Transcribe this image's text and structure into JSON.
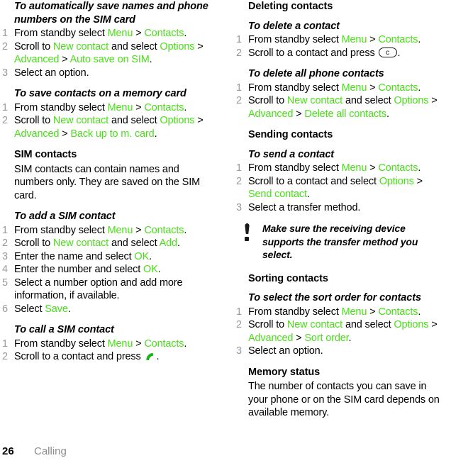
{
  "meta": {
    "accent_green": "#4ade18",
    "step_number_gray": "#9a9a9a",
    "footer_gray": "#8c8c8c"
  },
  "footer": {
    "page_number": "26",
    "chapter": "Calling"
  },
  "left_column": {
    "blocks": [
      {
        "type": "procedure",
        "title": "To automatically save names and phone numbers on the SIM card",
        "steps": [
          {
            "num": "1",
            "parts": [
              {
                "t": "From standby select ",
                "k": false
              },
              {
                "t": "Menu",
                "k": true
              },
              {
                "t": " > ",
                "k": false
              },
              {
                "t": "Contacts",
                "k": true
              },
              {
                "t": ".",
                "k": false
              }
            ]
          },
          {
            "num": "2",
            "parts": [
              {
                "t": "Scroll to ",
                "k": false
              },
              {
                "t": "New contact",
                "k": true
              },
              {
                "t": " and select ",
                "k": false
              },
              {
                "t": "Options",
                "k": true
              },
              {
                "t": " > ",
                "k": false
              },
              {
                "t": "Advanced",
                "k": true
              },
              {
                "t": " > ",
                "k": false
              },
              {
                "t": "Auto save on SIM",
                "k": true
              },
              {
                "t": ".",
                "k": false
              }
            ]
          },
          {
            "num": "3",
            "parts": [
              {
                "t": "Select an option.",
                "k": false
              }
            ]
          }
        ]
      },
      {
        "type": "procedure",
        "title": "To save contacts on a memory card",
        "steps": [
          {
            "num": "1",
            "parts": [
              {
                "t": "From standby select ",
                "k": false
              },
              {
                "t": "Menu",
                "k": true
              },
              {
                "t": " > ",
                "k": false
              },
              {
                "t": "Contacts",
                "k": true
              },
              {
                "t": ".",
                "k": false
              }
            ]
          },
          {
            "num": "2",
            "parts": [
              {
                "t": "Scroll to ",
                "k": false
              },
              {
                "t": "New contact",
                "k": true
              },
              {
                "t": " and select ",
                "k": false
              },
              {
                "t": "Options",
                "k": true
              },
              {
                "t": " > ",
                "k": false
              },
              {
                "t": "Advanced",
                "k": true
              },
              {
                "t": " > ",
                "k": false
              },
              {
                "t": "Back up to m. card",
                "k": true
              },
              {
                "t": ".",
                "k": false
              }
            ]
          }
        ]
      },
      {
        "type": "section",
        "title": "SIM contacts",
        "paragraph": "SIM contacts can contain names and numbers only. They are saved on the SIM card."
      },
      {
        "type": "procedure",
        "title": "To add a SIM contact",
        "steps": [
          {
            "num": "1",
            "parts": [
              {
                "t": "From standby select ",
                "k": false
              },
              {
                "t": "Menu",
                "k": true
              },
              {
                "t": " > ",
                "k": false
              },
              {
                "t": "Contacts",
                "k": true
              },
              {
                "t": ".",
                "k": false
              }
            ]
          },
          {
            "num": "2",
            "parts": [
              {
                "t": "Scroll to ",
                "k": false
              },
              {
                "t": "New contact",
                "k": true
              },
              {
                "t": " and select ",
                "k": false
              },
              {
                "t": "Add",
                "k": true
              },
              {
                "t": ".",
                "k": false
              }
            ]
          },
          {
            "num": "3",
            "parts": [
              {
                "t": "Enter the name and select ",
                "k": false
              },
              {
                "t": "OK",
                "k": true
              },
              {
                "t": ".",
                "k": false
              }
            ]
          },
          {
            "num": "4",
            "parts": [
              {
                "t": "Enter the number and select ",
                "k": false
              },
              {
                "t": "OK",
                "k": true
              },
              {
                "t": ".",
                "k": false
              }
            ]
          },
          {
            "num": "5",
            "parts": [
              {
                "t": "Select a number option and add more information, if available.",
                "k": false
              }
            ]
          },
          {
            "num": "6",
            "parts": [
              {
                "t": "Select ",
                "k": false
              },
              {
                "t": "Save",
                "k": true
              },
              {
                "t": ".",
                "k": false
              }
            ]
          }
        ]
      },
      {
        "type": "procedure",
        "title": "To call a SIM contact",
        "steps": [
          {
            "num": "1",
            "parts": [
              {
                "t": "From standby select ",
                "k": false
              },
              {
                "t": "Menu",
                "k": true
              },
              {
                "t": " > ",
                "k": false
              },
              {
                "t": "Contacts",
                "k": true
              },
              {
                "t": ".",
                "k": false
              }
            ]
          },
          {
            "num": "2",
            "parts": [
              {
                "t": "Scroll to a contact and press ",
                "k": false
              },
              {
                "icon": "call-key-icon"
              },
              {
                "t": ".",
                "k": false
              }
            ]
          }
        ]
      }
    ]
  },
  "right_column": {
    "blocks": [
      {
        "type": "section",
        "title": "Deleting contacts"
      },
      {
        "type": "procedure",
        "title": "To delete a contact",
        "steps": [
          {
            "num": "1",
            "parts": [
              {
                "t": "From standby select ",
                "k": false
              },
              {
                "t": "Menu",
                "k": true
              },
              {
                "t": " > ",
                "k": false
              },
              {
                "t": "Contacts",
                "k": true
              },
              {
                "t": ".",
                "k": false
              }
            ]
          },
          {
            "num": "2",
            "parts": [
              {
                "t": "Scroll to a contact and press ",
                "k": false
              },
              {
                "icon": "clear-key-icon",
                "label": "c"
              },
              {
                "t": ".",
                "k": false
              }
            ]
          }
        ]
      },
      {
        "type": "procedure",
        "title": "To delete all phone contacts",
        "steps": [
          {
            "num": "1",
            "parts": [
              {
                "t": "From standby select ",
                "k": false
              },
              {
                "t": "Menu",
                "k": true
              },
              {
                "t": " > ",
                "k": false
              },
              {
                "t": "Contacts",
                "k": true
              },
              {
                "t": ".",
                "k": false
              }
            ]
          },
          {
            "num": "2",
            "parts": [
              {
                "t": "Scroll to ",
                "k": false
              },
              {
                "t": "New contact",
                "k": true
              },
              {
                "t": " and select ",
                "k": false
              },
              {
                "t": "Options",
                "k": true
              },
              {
                "t": " > ",
                "k": false
              },
              {
                "t": "Advanced",
                "k": true
              },
              {
                "t": " > ",
                "k": false
              },
              {
                "t": "Delete all contacts",
                "k": true
              },
              {
                "t": ".",
                "k": false
              }
            ]
          }
        ]
      },
      {
        "type": "section",
        "title": "Sending contacts"
      },
      {
        "type": "procedure",
        "title": "To send a contact",
        "steps": [
          {
            "num": "1",
            "parts": [
              {
                "t": "From standby select ",
                "k": false
              },
              {
                "t": "Menu",
                "k": true
              },
              {
                "t": " > ",
                "k": false
              },
              {
                "t": "Contacts",
                "k": true
              },
              {
                "t": ".",
                "k": false
              }
            ]
          },
          {
            "num": "2",
            "parts": [
              {
                "t": "Scroll to a contact and select ",
                "k": false
              },
              {
                "t": "Options",
                "k": true
              },
              {
                "t": " > ",
                "k": false
              },
              {
                "t": "Send contact",
                "k": true
              },
              {
                "t": ".",
                "k": false
              }
            ]
          },
          {
            "num": "3",
            "parts": [
              {
                "t": "Select a transfer method.",
                "k": false
              }
            ]
          }
        ]
      },
      {
        "type": "note",
        "icon": "exclamation-note-icon",
        "text": "Make sure the receiving device supports the transfer method you select."
      },
      {
        "type": "section",
        "title": "Sorting contacts"
      },
      {
        "type": "procedure",
        "title": "To select the sort order for contacts",
        "steps": [
          {
            "num": "1",
            "parts": [
              {
                "t": "From standby select ",
                "k": false
              },
              {
                "t": "Menu",
                "k": true
              },
              {
                "t": " > ",
                "k": false
              },
              {
                "t": "Contacts",
                "k": true
              },
              {
                "t": ".",
                "k": false
              }
            ]
          },
          {
            "num": "2",
            "parts": [
              {
                "t": "Scroll to ",
                "k": false
              },
              {
                "t": "New contact",
                "k": true
              },
              {
                "t": " and select ",
                "k": false
              },
              {
                "t": "Options",
                "k": true
              },
              {
                "t": " > ",
                "k": false
              },
              {
                "t": "Advanced",
                "k": true
              },
              {
                "t": " > ",
                "k": false
              },
              {
                "t": "Sort order",
                "k": true
              },
              {
                "t": ".",
                "k": false
              }
            ]
          },
          {
            "num": "3",
            "parts": [
              {
                "t": "Select an option.",
                "k": false
              }
            ]
          }
        ]
      },
      {
        "type": "section",
        "title": "Memory status",
        "paragraph": "The number of contacts you can save in your phone or on the SIM card depends on available memory."
      }
    ]
  }
}
